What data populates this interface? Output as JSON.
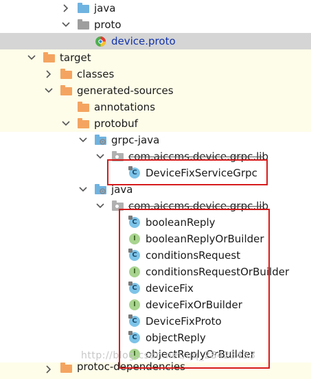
{
  "tree": {
    "java_folder": "java",
    "proto_folder": "proto",
    "proto_file": "device.proto",
    "target": "target",
    "classes": "classes",
    "generated_sources": "generated-sources",
    "annotations": "annotations",
    "protobuf": "protobuf",
    "grpc_java": "grpc-java",
    "grpc_package": "com.aiccms.device.grpc.lib",
    "grpc_class": "DeviceFixServiceGrpc",
    "java_gen": "java",
    "java_package": "com.aiccms.device.grpc.lib",
    "items": [
      {
        "label": "booleanReply",
        "kind": "C"
      },
      {
        "label": "booleanReplyOrBuilder",
        "kind": "I"
      },
      {
        "label": "conditionsRequest",
        "kind": "C"
      },
      {
        "label": "conditionsRequestOrBuilder",
        "kind": "I"
      },
      {
        "label": "deviceFix",
        "kind": "C"
      },
      {
        "label": "deviceFixOrBuilder",
        "kind": "I"
      },
      {
        "label": "DeviceFixProto",
        "kind": "C"
      },
      {
        "label": "objectReply",
        "kind": "C"
      },
      {
        "label": "objectReplyOrBuilder",
        "kind": "I"
      }
    ],
    "protoc_dependencies": "protoc-dependencies"
  },
  "watermark": "http://blog.csdn.net/qq_28423433",
  "colors": {
    "highlight_box": "#d61a1a",
    "folder_orange": "#f4a460",
    "folder_blue": "#6fb3e0",
    "folder_gray": "#9e9e9e",
    "class_icon": "#7dc3e8",
    "interface_icon": "#a8d48f"
  }
}
